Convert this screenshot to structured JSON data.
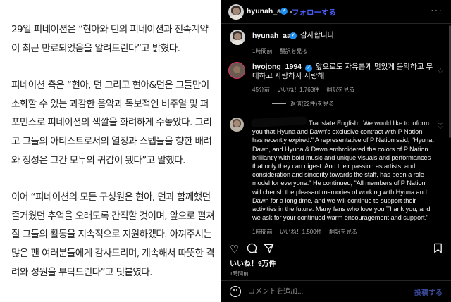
{
  "article": {
    "paragraphs": [
      "29일 피네이션은 “현아와 던의 피네이션과 전속계약이 최근 만료되었음을 알려드린다”고 밝혔다.",
      "피네이션 측은 “현아, 던 그리고 현아&던은 그들만이 소화할 수 있는 과감한 음악과 독보적인 비주얼 및 퍼포먼스로 피네이션의 색깔을 화려하게 수놓았다. 그리고 그들의 아티스트로서의 열정과 스텝들을 향한 배려와 정성은 그간 모두의 귀감이 됐다”고 말했다.",
      "이어 “피네이션의 모든 구성원은 현아, 던과 함께했던 즐거웠던 추억을 오래도록 간직할 것이며, 앞으로 펼쳐질 그들의 활동을 지속적으로 지원하겠다. 아껴주시는 많은 팬 여러분들에게 감사드리며, 계속해서 따뜻한 격려와 성원을 부탁드린다”고 덧붙였다."
    ]
  },
  "instagram": {
    "header": {
      "username": "hyunah_aa",
      "dot": "・",
      "follow_label": "フォローする",
      "more": "···"
    },
    "comments": [
      {
        "username": "hyunah_aa",
        "text": "감사합니다.",
        "time": "1時間前",
        "translate": "翻訳を見る"
      },
      {
        "username": "hyojong_1994",
        "text": "앞으로도 자유롭게 멋있게 음악하고 무대하고 사랑하자 사랑해",
        "time": "45分前",
        "likes": "いいね！1,763件",
        "translate": "翻訳を見る",
        "replies": "返信(22件)を見る"
      },
      {
        "text": "Translate English : We would like to inform you that Hyuna and Dawn's exclusive contract with P Nation has recently expired.\" A representative of P Nation said, \"Hyuna, Dawn, and Hyuna & Dawn embroidered the colors of P Nation brilliantly with bold music and unique visuals and performances that only they can digest. And their passion as artists, and consideration and sincerity towards the staff, has been a role model for everyone.\" He continued, \"All members of P Nation will cherish the pleasant memories of working with Hyuna and Dawn for a long time, and we will continue to support their activities in the future. Many fans who love you Thank you, and we ask for your continued warm encouragement and support.\"",
        "time": "1時間前",
        "likes": "いいね！1,500件",
        "translate": "翻訳を見る"
      }
    ],
    "likes_total": "いいね！9万件",
    "posted": "1時間前",
    "comment_placeholder": "コメントを追加...",
    "post_label": "投稿する"
  }
}
